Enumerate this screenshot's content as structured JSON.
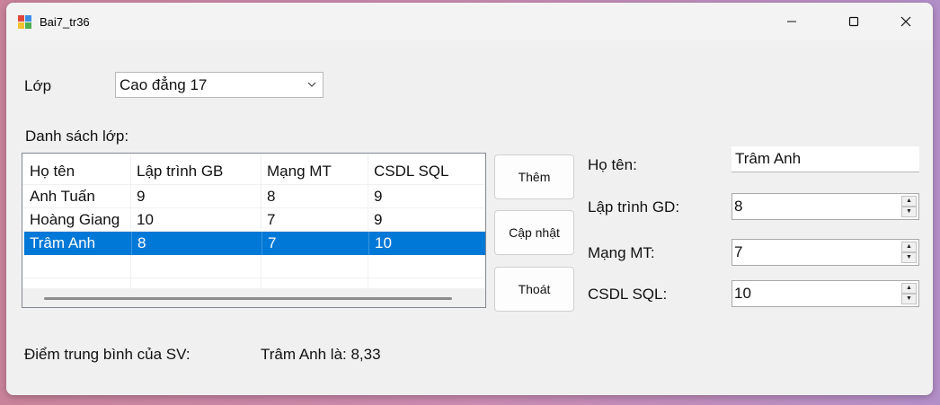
{
  "window": {
    "title": "Bai7_tr36",
    "controls": [
      "minimize",
      "maximize",
      "close"
    ]
  },
  "class_selector": {
    "label": "Lớp",
    "selected": "Cao đẳng 17"
  },
  "class_list": {
    "label": "Danh sách lớp:",
    "columns": [
      "Họ tên",
      "Lập trình GB",
      "Mạng MT",
      "CSDL SQL"
    ],
    "rows": [
      [
        "Anh Tuấn",
        "9",
        "8",
        "9"
      ],
      [
        "Hoàng Giang",
        "10",
        "7",
        "9"
      ],
      [
        "Trâm Anh",
        "8",
        "7",
        "10"
      ]
    ],
    "selected_row_index": 2,
    "selection_color": "#0078d7"
  },
  "buttons": {
    "add": "Thêm",
    "update": "Cập nhật",
    "exit": "Thoát"
  },
  "form": {
    "name_label": "Họ tên:",
    "name_value": "Trâm Anh",
    "programming_label": "Lập trình GD:",
    "programming_value": "8",
    "network_label": "Mạng MT:",
    "network_value": "7",
    "sql_label": "CSDL SQL:",
    "sql_value": "10"
  },
  "result": {
    "label": "Điểm trung bình của SV:",
    "value": "Trâm Anh là: 8,33"
  }
}
